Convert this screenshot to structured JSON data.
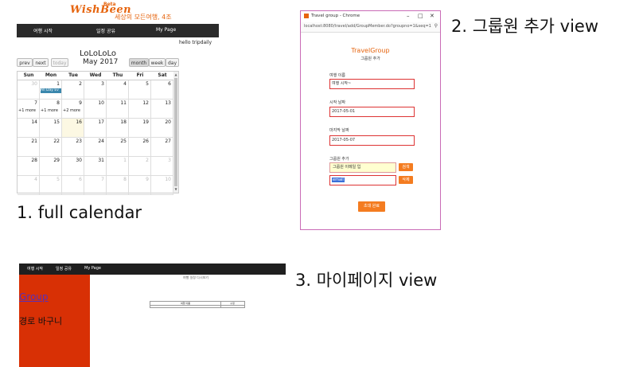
{
  "panel1": {
    "logo": "WishBeen",
    "logo_badge": "Beta",
    "tagline": "세상의 모든여행, 4조",
    "nav": [
      "여행 시작",
      "일정 공유",
      "My Page"
    ],
    "hello": "hello tripdaily",
    "calendar_name": "LoLoLoLo",
    "month_title": "May 2017",
    "buttons": {
      "prev": "prev",
      "next": "next",
      "today": "today",
      "month": "month",
      "week": "week",
      "day": "day"
    },
    "weekdays": [
      "Sun",
      "Mon",
      "Tue",
      "Wed",
      "Thu",
      "Fri",
      "Sat"
    ],
    "weeks": [
      [
        "30",
        "1",
        "2",
        "3",
        "4",
        "5",
        "6"
      ],
      [
        "7",
        "8",
        "9",
        "10",
        "11",
        "12",
        "13"
      ],
      [
        "14",
        "15",
        "16",
        "17",
        "18",
        "19",
        "20"
      ],
      [
        "21",
        "22",
        "23",
        "24",
        "25",
        "26",
        "27"
      ],
      [
        "28",
        "29",
        "30",
        "31",
        "1",
        "2",
        "3"
      ],
      [
        "4",
        "5",
        "6",
        "7",
        "8",
        "9",
        "10"
      ]
    ],
    "event": "All Day Ev",
    "more_links": {
      "sun": "+1 more",
      "mon": "+1 more",
      "tue": "+2 more"
    },
    "caption": "1. full calendar"
  },
  "panel2": {
    "window_title": "Travel group - Chrome",
    "window_controls": [
      "–",
      "□",
      "✕"
    ],
    "url": "localhost:8080/travel/add/GroupMember.do?groupno=1&seq=1",
    "app_title": "TravelGroup",
    "app_subtitle": "그룹원 추가",
    "fields": [
      {
        "label": "여행 이름",
        "value": "여행 시작~"
      },
      {
        "label": "시작 날짜",
        "value": "2017-05-01"
      },
      {
        "label": "마지막 날짜",
        "value": "2017-05-07"
      }
    ],
    "member_label": "그룹원 추가",
    "member_input": "그룹원 이메일 입",
    "member_input2": "email",
    "check_button": "검색",
    "delete_button": "삭제",
    "submit_button": "초대 완료",
    "caption": "2. 그룹원 추가 view"
  },
  "panel3": {
    "nav": [
      "여행 시작",
      "일정 공유",
      "My Page"
    ],
    "group_link": "Group",
    "basket_text": "경로 바구니",
    "main_link": "여행 일정 다시보기",
    "table_headers": [
      "여행 이름",
      "수정"
    ],
    "caption": "3. 마이페이지 view"
  },
  "colors": {
    "accent": "#e6640e",
    "sidebar": "#d83005",
    "navbar": "#2a2a2a",
    "event": "#3a87ad"
  }
}
